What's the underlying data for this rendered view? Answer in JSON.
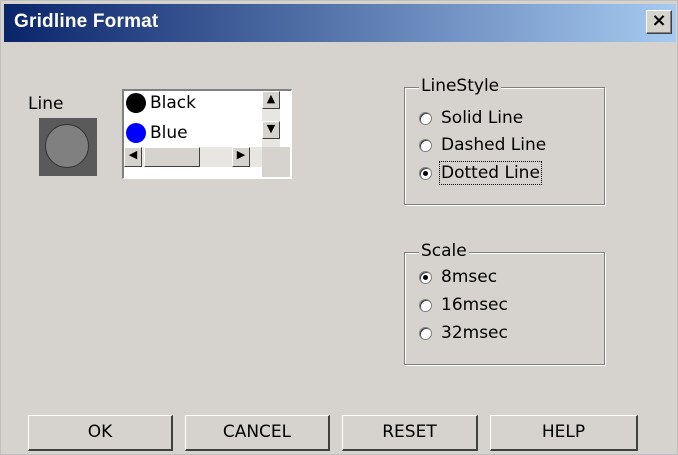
{
  "window": {
    "title": "Gridline Format",
    "close_label": "×"
  },
  "line": {
    "label": "Line",
    "swatch_color": "#808080"
  },
  "color_list": {
    "items": [
      {
        "label": "Black",
        "color": "#000000"
      },
      {
        "label": "Blue",
        "color": "#0000ff"
      }
    ]
  },
  "linestyle": {
    "legend": "LineStyle",
    "options": [
      {
        "label": "Solid Line",
        "selected": false
      },
      {
        "label": "Dashed Line",
        "selected": false
      },
      {
        "label": "Dotted Line",
        "selected": true
      }
    ]
  },
  "scale": {
    "legend": "Scale",
    "options": [
      {
        "label": "8msec",
        "selected": true
      },
      {
        "label": "16msec",
        "selected": false
      },
      {
        "label": "32msec",
        "selected": false
      }
    ]
  },
  "buttons": {
    "ok": "OK",
    "cancel": "CANCEL",
    "reset": "RESET",
    "help": "HELP"
  },
  "colors": {
    "titlebar_start": "#0a246a",
    "titlebar_end": "#a6caf0",
    "dialog_face": "#d6d3ce"
  }
}
